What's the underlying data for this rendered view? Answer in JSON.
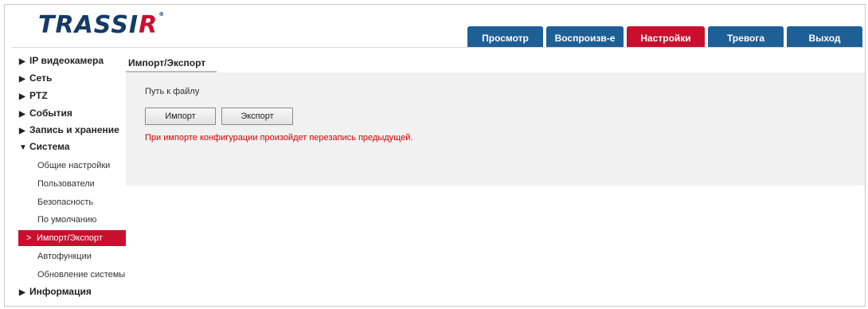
{
  "header": {
    "logo_main": "TRASSI",
    "logo_r": "R"
  },
  "tabs": [
    {
      "label": "Просмотр",
      "active": false
    },
    {
      "label": "Воспроизв-е",
      "active": false
    },
    {
      "label": "Настройки",
      "active": true
    },
    {
      "label": "Тревога",
      "active": false
    },
    {
      "label": "Выход",
      "active": false
    }
  ],
  "sidebar": {
    "items": [
      {
        "label": "IP видеокамера",
        "arrow": "▶"
      },
      {
        "label": "Сеть",
        "arrow": "▶"
      },
      {
        "label": "PTZ",
        "arrow": "▶"
      },
      {
        "label": "События",
        "arrow": "▶"
      },
      {
        "label": "Запись и хранение",
        "arrow": "▶"
      },
      {
        "label": "Система",
        "arrow": "▼"
      },
      {
        "label": "Информация",
        "arrow": "▶"
      }
    ],
    "system_subitems": [
      {
        "label": "Общие настройки"
      },
      {
        "label": "Пользователи"
      },
      {
        "label": "Безопасность"
      },
      {
        "label": "По умолчанию"
      },
      {
        "label": "Импорт/Экспорт",
        "active": true,
        "chevron": ">"
      },
      {
        "label": "Автофункции"
      },
      {
        "label": "Обновление системы"
      }
    ]
  },
  "main": {
    "tab_label": "Импорт/Экспорт",
    "path_label": "Путь к файлу",
    "import_button": "Импорт",
    "export_button": "Экспорт",
    "warning": "При импорте конфигурации произойдет перезапись предыдущей."
  },
  "colors": {
    "accent": "#c8102e",
    "tab_blue": "#1e5f96",
    "panel_bg": "#f1f1f1"
  }
}
